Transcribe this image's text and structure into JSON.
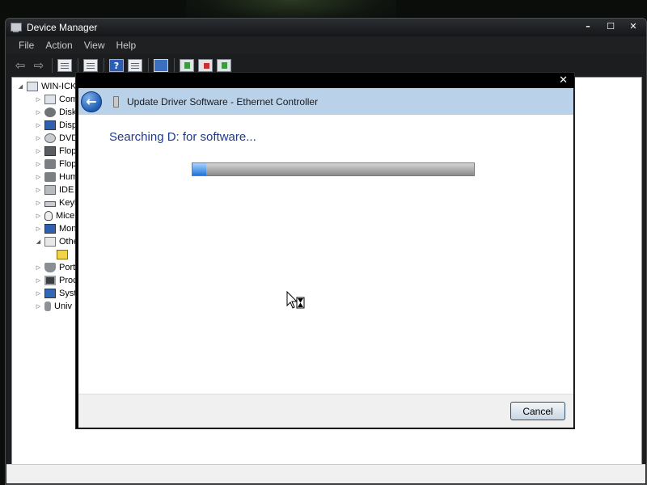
{
  "window": {
    "title": "Device Manager",
    "controls": [
      "–",
      "☐",
      "✕"
    ]
  },
  "menu": [
    "File",
    "Action",
    "View",
    "Help"
  ],
  "toolbar": {
    "buttons": [
      "back-arrow-icon",
      "forward-arrow-icon",
      "properties-icon",
      "console-icon",
      "help-icon",
      "monitor-view-icon",
      "scan-hardware-icon",
      "update-driver-icon",
      "uninstall-icon",
      "disable-icon"
    ]
  },
  "tree": {
    "root": "WIN-ICK",
    "items": [
      {
        "label": "Com",
        "icon": "computer-icon"
      },
      {
        "label": "Disk",
        "icon": "disk-icon"
      },
      {
        "label": "Disp",
        "icon": "display-icon"
      },
      {
        "label": "DVD",
        "icon": "dvd-icon"
      },
      {
        "label": "Flop",
        "icon": "floppy-icon"
      },
      {
        "label": "Flop",
        "icon": "floppy-controller-icon"
      },
      {
        "label": "Hum",
        "icon": "hid-icon"
      },
      {
        "label": "IDE",
        "icon": "ide-icon"
      },
      {
        "label": "Keyb",
        "icon": "keyboard-icon"
      },
      {
        "label": "Mice",
        "icon": "mouse-icon"
      },
      {
        "label": "Mon",
        "icon": "monitor-icon"
      },
      {
        "label": "Othe",
        "icon": "other-devices-icon"
      },
      {
        "label": "",
        "icon": "warning-device-icon"
      },
      {
        "label": "Port",
        "icon": "port-icon"
      },
      {
        "label": "Proc",
        "icon": "processor-icon"
      },
      {
        "label": "Syst",
        "icon": "system-icon"
      },
      {
        "label": "Univ",
        "icon": "usb-icon"
      }
    ]
  },
  "dialog": {
    "close": "✕",
    "back": "←",
    "title": "Update Driver Software - Ethernet Controller",
    "heading": "Searching D: for software...",
    "progress": 0.05,
    "cancel": "Cancel"
  },
  "colors": {
    "header": "#b9d2ea",
    "heading_text": "#1e3a8a",
    "progress_fill": "#1f74d8"
  }
}
